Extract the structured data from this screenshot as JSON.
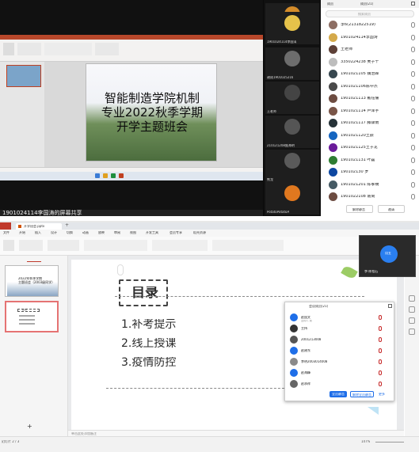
{
  "top": {
    "slide": {
      "line1": "智能制造学院机制",
      "line2": "专业2022秋季学期",
      "line3": "开学主题班会"
    },
    "sharer_label": "19010241​14李国涛的屏幕共享",
    "videos": [
      {
        "name": ""
      },
      {
        "name": "1901024114李国涛"
      },
      {
        "name": "谢成1901025216"
      },
      {
        "name": "王老师"
      },
      {
        "name": "210121208庞海明"
      },
      {
        "name": "熊龙"
      },
      {
        "name": "PotatoPotatoA"
      }
    ],
    "members": {
      "header_left": "成员",
      "header_right": "成员(21)",
      "search_placeholder": "搜索成员",
      "rows": [
        {
          "name": "李6(2131822519)"
        },
        {
          "name": "1901024114李国涛"
        },
        {
          "name": "王老师"
        },
        {
          "name": "3350224238 吴子千"
        },
        {
          "name": "1901021105 魏治霖"
        },
        {
          "name": "1901021106陈中杰"
        },
        {
          "name": "1901021113 戴钰儒"
        },
        {
          "name": "1901021114 卢泽宇"
        },
        {
          "name": "1901021117 滕康南"
        },
        {
          "name": "1901021120王振"
        },
        {
          "name": "1901021125王子龙"
        },
        {
          "name": "1901021131 叶磊"
        },
        {
          "name": "190102130 罗"
        },
        {
          "name": "1901021201 陈孝楠"
        },
        {
          "name": "1901022108 谢尚"
        }
      ],
      "btn_unmute": "解除静音",
      "btn_invite": "邀请"
    }
  },
  "bottom": {
    "file_tab": "开学班会.pptx",
    "menu": [
      "文件",
      "开始",
      "插入",
      "设计",
      "切换",
      "动画",
      "放映",
      "审阅",
      "视图",
      "开发工具",
      "会员专享",
      "稻壳资源"
    ],
    "panel_tabs": [
      "大纲",
      "幻灯片"
    ],
    "thumb1_title": "2022年秋季学期\n主题班会（2003级同学）",
    "thumb2_label": "目录",
    "slide": {
      "title": "目录",
      "items": [
        "1.补考提示",
        "2.线上授课",
        "3.疫情防控"
      ]
    },
    "notes_placeholder": "单击此处添加备注",
    "status_left": "幻灯片 2 / 3",
    "zoom": "147%",
    "meet_button": "用五",
    "meet_name": "李·陈相石",
    "popup": {
      "title": "会议成员(21)",
      "rows": [
        {
          "name": "赵国文",
          "sub": "主持人, 我"
        },
        {
          "name": "主持",
          "sub": ""
        },
        {
          "name": "2001213008",
          "sub": ""
        },
        {
          "name": "赵建东",
          "sub": ""
        },
        {
          "name": "李明2003014008",
          "sub": ""
        },
        {
          "name": "赵海峰",
          "sub": ""
        },
        {
          "name": "赵承祥",
          "sub": ""
        }
      ],
      "btn1": "全员静音",
      "btn2": "解除全员静音",
      "btn3": "更多"
    }
  }
}
